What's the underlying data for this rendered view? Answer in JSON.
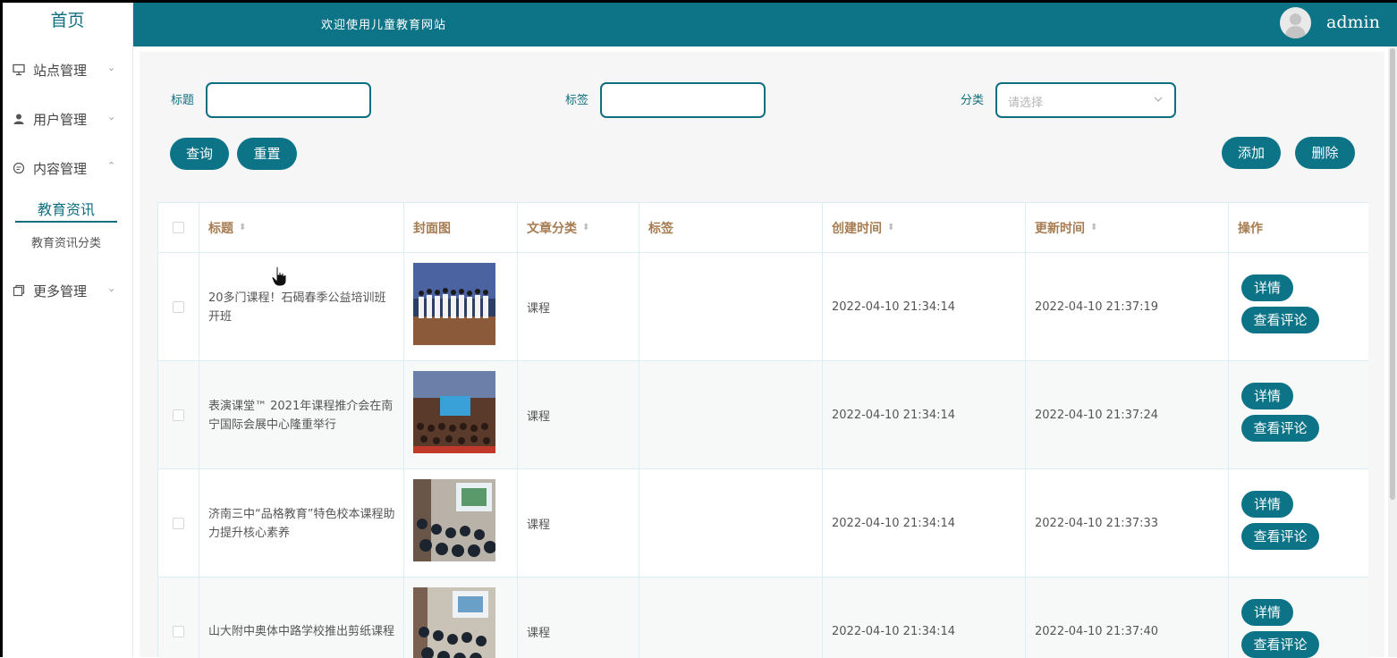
{
  "sidebar": {
    "home": "首页",
    "items": [
      {
        "label": "站点管理",
        "icon": "monitor-icon",
        "chevron": "⌄"
      },
      {
        "label": "用户管理",
        "icon": "user-icon",
        "chevron": "⌄"
      },
      {
        "label": "内容管理",
        "icon": "message-icon",
        "chevron": "⌃"
      },
      {
        "label": "更多管理",
        "icon": "copy-icon",
        "chevron": "⌄"
      }
    ],
    "sub_active": "教育资讯",
    "sub_item": "教育资讯分类"
  },
  "header": {
    "welcome": "欢迎使用儿童教育网站",
    "username": "admin"
  },
  "filters": {
    "title_label": "标题",
    "tag_label": "标签",
    "category_label": "分类",
    "category_placeholder": "请选择"
  },
  "buttons": {
    "search": "查询",
    "reset": "重置",
    "add": "添加",
    "delete": "删除"
  },
  "table": {
    "columns": [
      "标题",
      "封面图",
      "文章分类",
      "标签",
      "创建时间",
      "更新时间",
      "操作"
    ],
    "rows": [
      {
        "title": "20多门课程！石碣春季公益培训班开班",
        "category": "课程",
        "tags": "",
        "created": "2022-04-10 21:34:14",
        "updated": "2022-04-10 21:37:19"
      },
      {
        "title": "表演课堂™ 2021年课程推介会在南宁国际会展中心隆重举行",
        "category": "课程",
        "tags": "",
        "created": "2022-04-10 21:34:14",
        "updated": "2022-04-10 21:37:24"
      },
      {
        "title": "济南三中“品格教育”特色校本课程助力提升核心素养",
        "category": "课程",
        "tags": "",
        "created": "2022-04-10 21:34:14",
        "updated": "2022-04-10 21:37:33"
      },
      {
        "title": "山大附中奥体中路学校推出剪纸课程",
        "category": "课程",
        "tags": "",
        "created": "2022-04-10 21:34:14",
        "updated": "2022-04-10 21:37:40"
      }
    ],
    "action_detail": "详情",
    "action_comments": "查看评论"
  },
  "colors": {
    "primary": "#0d7488",
    "header_text": "#a67c52"
  }
}
